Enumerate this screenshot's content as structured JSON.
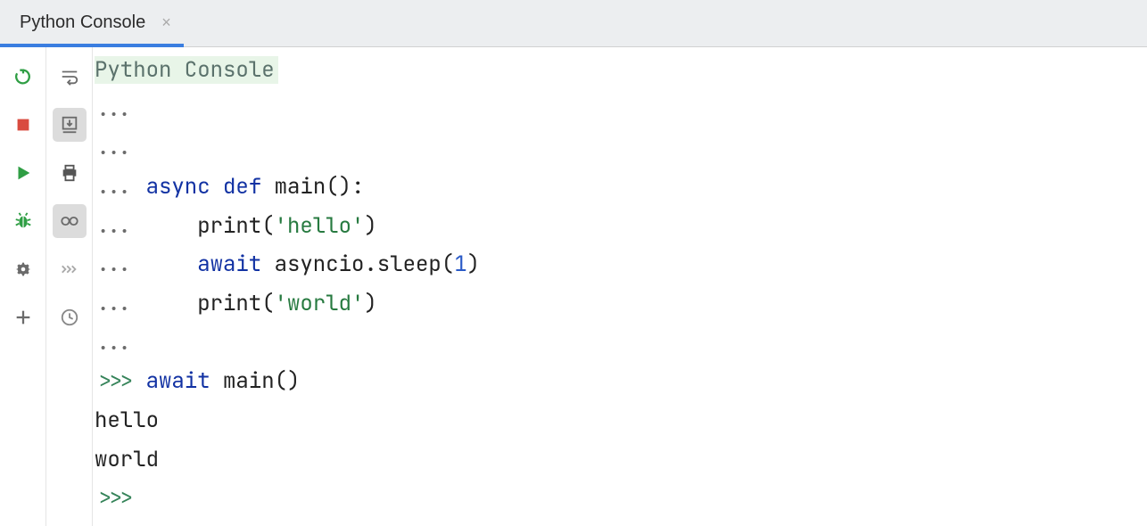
{
  "tab": {
    "label": "Python Console"
  },
  "banner": "Python Console",
  "lines": {
    "l1_prompt": "...",
    "l2_prompt": "...",
    "l3_prompt": "... ",
    "l3_kw1": "async",
    "l3_kw2": "def",
    "l3_fn": " main():",
    "l4_prompt": "...     ",
    "l4_call": "print(",
    "l4_str": "'hello'",
    "l4_close": ")",
    "l5_prompt": "...     ",
    "l5_kw": "await",
    "l5_txt1": " asyncio.sleep(",
    "l5_num": "1",
    "l5_close": ")",
    "l6_prompt": "...     ",
    "l6_call": "print(",
    "l6_str": "'world'",
    "l6_close": ")",
    "l7_prompt": "...",
    "l8_prompt": ">>> ",
    "l8_kw": "await",
    "l8_txt": " main()",
    "l9_out": "hello",
    "l10_out": "world",
    "l11_prompt": ">>> "
  }
}
